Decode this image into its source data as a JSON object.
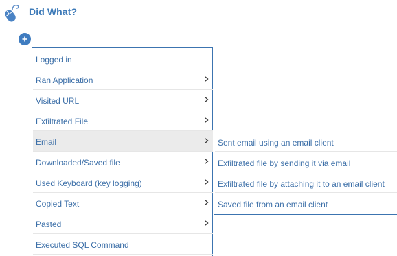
{
  "header": {
    "title": "Did What?",
    "icon": "mouse-icon",
    "accent_color": "#3d7ab8"
  },
  "add_button": {
    "icon": "plus-icon",
    "color": "#3f7cc0"
  },
  "menu": {
    "border_color": "#3c74b0",
    "text_color": "#3c6fa8",
    "active_background": "#ebebeb",
    "items": [
      {
        "label": "Logged in",
        "has_submenu": false,
        "active": false
      },
      {
        "label": "Ran Application",
        "has_submenu": true,
        "active": false
      },
      {
        "label": "Visited URL",
        "has_submenu": true,
        "active": false
      },
      {
        "label": "Exfiltrated File",
        "has_submenu": true,
        "active": false
      },
      {
        "label": "Email",
        "has_submenu": true,
        "active": true
      },
      {
        "label": "Downloaded/Saved file",
        "has_submenu": true,
        "active": false
      },
      {
        "label": "Used Keyboard (key logging)",
        "has_submenu": true,
        "active": false
      },
      {
        "label": "Copied Text",
        "has_submenu": true,
        "active": false
      },
      {
        "label": "Pasted",
        "has_submenu": true,
        "active": false
      },
      {
        "label": "Executed SQL Command",
        "has_submenu": false,
        "active": false
      }
    ]
  },
  "submenu": {
    "items": [
      {
        "label": "Sent email using an email client"
      },
      {
        "label": "Exfiltrated file by sending it via email"
      },
      {
        "label": "Exfiltrated file by attaching it to an email client"
      },
      {
        "label": "Saved file from an email client"
      }
    ]
  }
}
